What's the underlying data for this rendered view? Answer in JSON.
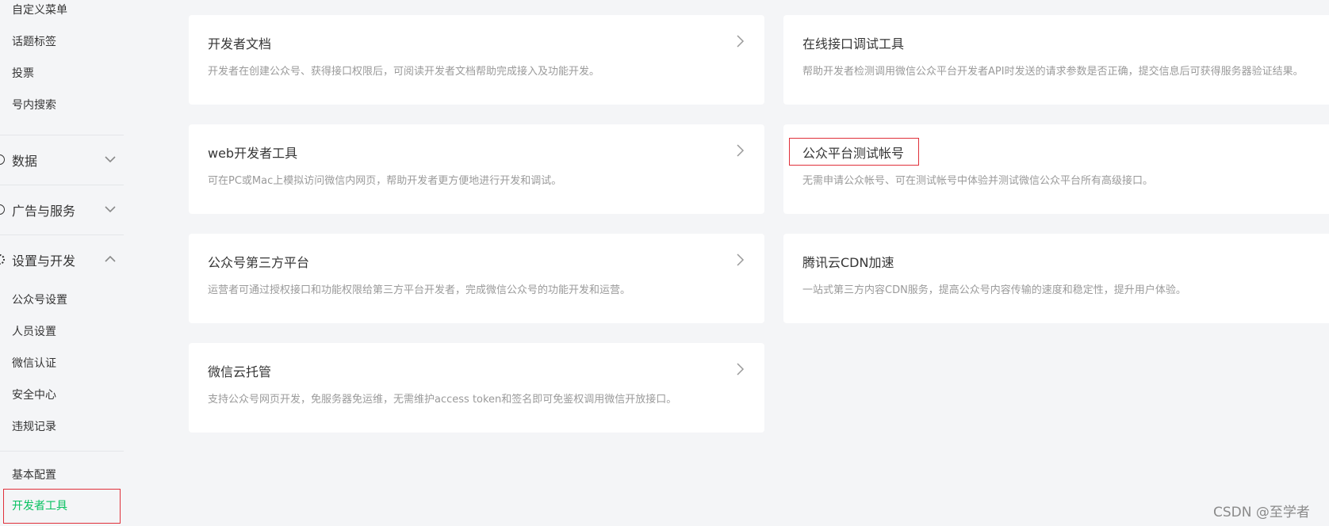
{
  "sidebar": {
    "top_items": [
      "自定义菜单",
      "话题标签",
      "投票",
      "号内搜索"
    ],
    "groups": [
      {
        "label": "数据",
        "icon": "data-icon",
        "expanded": false
      },
      {
        "label": "广告与服务",
        "icon": "ad-service-icon",
        "expanded": false
      },
      {
        "label": "设置与开发",
        "icon": "settings-gear-icon",
        "expanded": true
      }
    ],
    "settings_items": [
      "公众号设置",
      "人员设置",
      "微信认证",
      "安全中心",
      "违规记录"
    ],
    "dev_items": [
      "基本配置",
      "开发者工具"
    ],
    "active_item": "开发者工具",
    "active_color": "#07c160"
  },
  "cards": [
    {
      "title": "开发者文档",
      "desc": "开发者在创建公众号、获得接口权限后，可阅读开发者文档帮助完成接入及功能开发。"
    },
    {
      "title": "在线接口调试工具",
      "desc": "帮助开发者检测调用微信公众平台开发者API时发送的请求参数是否正确，提交信息后可获得服务器验证结果。"
    },
    {
      "title": "web开发者工具",
      "desc": "可在PC或Mac上模拟访问微信内网页，帮助开发者更方便地进行开发和调试。"
    },
    {
      "title": "公众平台测试帐号",
      "desc": "无需申请公众帐号、可在测试帐号中体验并测试微信公众平台所有高级接口。"
    },
    {
      "title": "公众号第三方平台",
      "desc": "运营者可通过授权接口和功能权限给第三方平台开发者，完成微信公众号的功能开发和运营。"
    },
    {
      "title": "腾讯云CDN加速",
      "desc": "一站式第三方内容CDN服务，提高公众号内容传输的速度和稳定性，提升用户体验。"
    },
    {
      "title": "微信云托管",
      "desc": "支持公众号网页开发，免服务器免运维，无需维护access token和签名即可免鉴权调用微信开放接口。"
    }
  ],
  "annotation_color": "#e0303a",
  "watermark": "CSDN @至学者"
}
